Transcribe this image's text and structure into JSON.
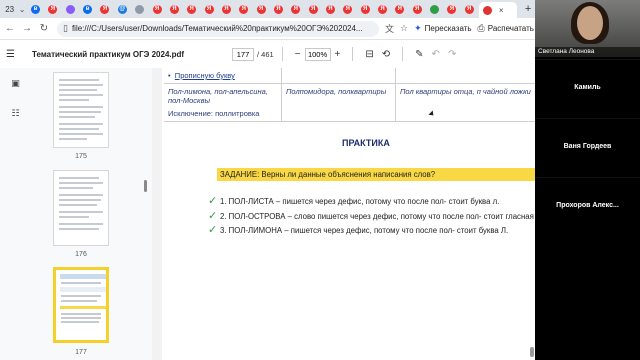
{
  "browser": {
    "tab_count": "23",
    "url": "file:///C:/Users/user/Downloads/Тематический%20практикум%20ОГЭ%202024...",
    "retell_label": "Пересказать",
    "print_label": "Распечатать"
  },
  "pdf": {
    "doc_title": "Тематический практикум ОГЭ 2024.pdf",
    "current_page": "177",
    "total_pages": "/ 461",
    "zoom": "100%"
  },
  "thumbnails": [
    {
      "label": "175"
    },
    {
      "label": "176"
    },
    {
      "label": "177"
    }
  ],
  "doc": {
    "table": {
      "row1_col1": "Прописную букву",
      "row2_col1": "Пол-лимона, пол-апельсина, пол-Москвы",
      "row2_col2": "Полпомидора, полквартиры",
      "row2_col3": "Пол квартиры отца, п чайной ложки",
      "row3_col1": "Исключение: поллитровка"
    },
    "heading": "ПРАКТИКА",
    "task": "ЗАДАНИЕ: Верны ли данные объяснения написания слов?",
    "items": [
      "1.  ПОЛ-ЛИСТА – пишется через дефис, потому что после пол- стоит буква л.",
      "2.  ПОЛ-ОСТРОВА – слово пишется через дефис, потому что после пол- стоит гласная",
      "3.  ПОЛ-ЛИМОНА – пишется через дефис, потому что после пол- стоит буква Л."
    ]
  },
  "participants": {
    "self_name": "Светлана Леонова",
    "others": [
      "Камиль",
      "Ваня Гордеев",
      "Прохоров  Алекс..."
    ]
  }
}
